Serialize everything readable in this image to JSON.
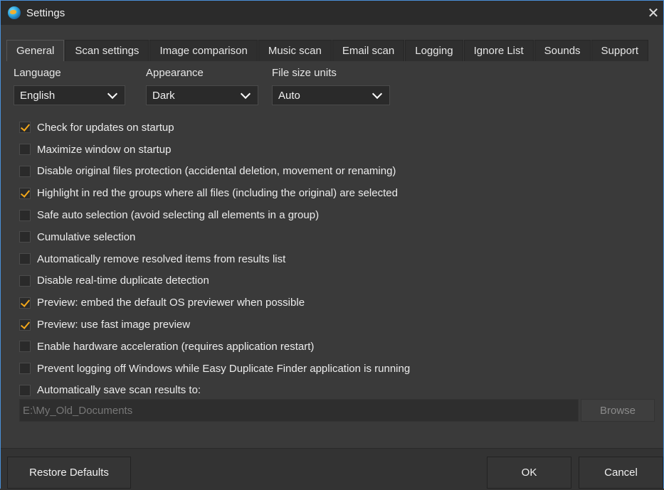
{
  "window": {
    "title": "Settings",
    "close_symbol": "✕"
  },
  "tabs": [
    {
      "label": "General",
      "active": true
    },
    {
      "label": "Scan settings"
    },
    {
      "label": "Image comparison"
    },
    {
      "label": "Music scan"
    },
    {
      "label": "Email scan"
    },
    {
      "label": "Logging"
    },
    {
      "label": "Ignore List"
    },
    {
      "label": "Sounds"
    },
    {
      "label": "Support"
    }
  ],
  "dropdowns": {
    "language": {
      "label": "Language",
      "value": "English"
    },
    "appearance": {
      "label": "Appearance",
      "value": "Dark"
    },
    "file_size_units": {
      "label": "File size units",
      "value": "Auto"
    }
  },
  "options": [
    {
      "label": "Check for updates on startup",
      "checked": true
    },
    {
      "label": "Maximize window on startup",
      "checked": false
    },
    {
      "label": "Disable original files protection (accidental deletion, movement or renaming)",
      "checked": false
    },
    {
      "label": "Highlight in red the groups where all files (including the original) are selected",
      "checked": true
    },
    {
      "label": "Safe auto selection (avoid selecting all elements in a group)",
      "checked": false
    },
    {
      "label": "Cumulative selection",
      "checked": false
    },
    {
      "label": "Automatically remove resolved items from results list",
      "checked": false
    },
    {
      "label": "Disable real-time duplicate detection",
      "checked": false
    },
    {
      "label": "Preview: embed the default OS previewer when possible",
      "checked": true
    },
    {
      "label": "Preview: use fast image preview",
      "checked": true
    },
    {
      "label": "Enable hardware acceleration (requires application restart)",
      "checked": false
    },
    {
      "label": "Prevent logging off Windows while Easy Duplicate Finder application is running",
      "checked": false
    },
    {
      "label": "Automatically save scan results to:",
      "checked": false
    }
  ],
  "save_path": {
    "value": "E:\\My_Old_Documents",
    "browse_label": "Browse"
  },
  "footer": {
    "restore_label": "Restore Defaults",
    "ok_label": "OK",
    "cancel_label": "Cancel"
  },
  "colors": {
    "accent_check": "#f2a71a",
    "window_border": "#4a90d9",
    "background": "#3a3a3a"
  }
}
